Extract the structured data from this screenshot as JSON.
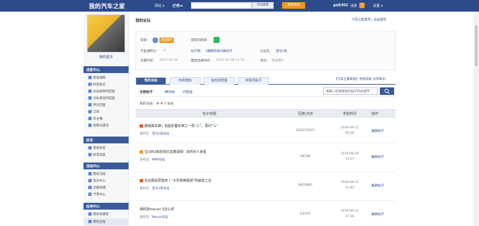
{
  "topbar": {
    "brand": "我的汽车之家",
    "nav": [
      "网站 ▾",
      "广场 ▾",
      "应用 ▾"
    ],
    "search_button": "论坛搜索",
    "post_button": "我要发帖",
    "username": "grj6302",
    "messages_label": "消息",
    "messages_count": "1",
    "settings_label": "设置 ▾"
  },
  "sidebar": {
    "my_home": "我的首页",
    "sections": [
      {
        "title": "消息中心",
        "items": [
          "系统通知",
          "好友私信",
          "论坛收到的回复",
          "论坛发出的回复",
          "评论回复",
          "订单",
          "车主播",
          "投稿与建议"
        ]
      },
      {
        "title": "好友",
        "items": [
          "我的好友",
          "好友动态"
        ]
      },
      {
        "title": "活动中心",
        "items": [
          "我的活动",
          "会员中心",
          "兑换商城",
          "卡券中心"
        ]
      },
      {
        "title": "应用中心",
        "items": [
          "我的优惠券",
          "我的主帖"
        ]
      }
    ]
  },
  "main": {
    "title": "我的论坛",
    "top_links": "汽车之家首页 | 论坛首页",
    "profile": {
      "level_label": "等级：",
      "level_num": "(1)",
      "level_tag": "青铜骑手",
      "medal_label": "获得的勋章：",
      "coins_label": "万里通积分：",
      "coins_value": "0",
      "posts_label": "帖子数：",
      "posts_value": "1篇精华帖/4篇帖子",
      "cert_label": "认证车：",
      "cert_value": "宝马1系",
      "reg_label": "注册时间：",
      "reg_value": "2012-02-29",
      "last_label": "最后登录时间：",
      "last_value": "2019-10-08 11:55",
      "identity_label": "身份：",
      "identity_value": "普通用户"
    },
    "tabs": [
      "我的主帖",
      "你的回帖",
      "发出的回复",
      "好友的帖子"
    ],
    "right_links": "【汽车之家知道】寻找答案 分享知识",
    "subtabs": [
      "全部帖子",
      "精华帖",
      "问答帖"
    ],
    "filter_placeholder": "请输入您要搜索的帖子的关键字",
    "count_prefix": "我的主帖：共",
    "count_value": "4",
    "count_suffix": "个主帖",
    "columns": [
      "帖子标题",
      "回复/点击",
      "发帖时间",
      "操作"
    ],
    "posts": [
      {
        "title": "撤销我车辆 | 黑超折叠标准之一而“三”，再问“三”",
        "board_label": "发布至：",
        "board": "宝马1系论坛",
        "reply": "2262/74237",
        "date": "2019-08-12",
        "time": "16:30",
        "op": "编辑帖子"
      },
      {
        "title": "宝马M2和轻骑次急降调相！刹然对人家看",
        "board_label": "发布至：",
        "board": "MINI论坛",
        "reply": "3/6780",
        "date": "2019-08-19",
        "time": "13:57",
        "op": "编辑帖子"
      },
      {
        "title": "车站我是原鼓高 | “大青辣黄最钱”的解放之征",
        "board_label": "发布至：",
        "board": "宝马1系论坛",
        "reply": "39/18962",
        "date": "2019-06-15",
        "time": "15:43",
        "op": "编辑帖子"
      },
      {
        "title": "保时捷macan S怎么样",
        "board_label": "发布至：",
        "board": "Macan论坛",
        "reply": "1/2101",
        "date": "2019-06-12",
        "time": "17:26",
        "op": "编辑帖子"
      }
    ]
  },
  "colors": {
    "brand": "#2d4a8a",
    "accent": "#f29a1b",
    "header": "#3a5a9a"
  }
}
